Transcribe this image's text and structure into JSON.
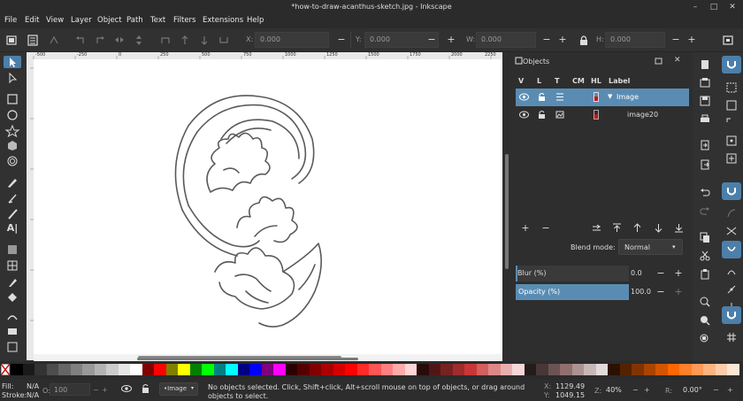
{
  "window": {
    "title": "*how-to-draw-acanthus-sketch.jpg - Inkscape",
    "controls": [
      "–",
      "□",
      "✕"
    ]
  },
  "menu": [
    "File",
    "Edit",
    "View",
    "Layer",
    "Object",
    "Path",
    "Text",
    "Filters",
    "Extensions",
    "Help"
  ],
  "toolbar": {
    "x_label": "X:",
    "x_value": "0.000",
    "y_label": "Y:",
    "y_value": "0.000",
    "w_label": "W:",
    "w_value": "0.000",
    "h_label": "H:",
    "h_value": "0.000",
    "minus": "−",
    "plus": "+"
  },
  "ruler": {
    "top_ticks": [
      "-500",
      "-250",
      "0",
      "250",
      "500",
      "750",
      "1000",
      "1250",
      "1500",
      "1750",
      "2000",
      "2250"
    ],
    "left_ticks": [
      "0",
      "250",
      "500",
      "750",
      "1000",
      "1250"
    ]
  },
  "objects_panel": {
    "title": "Objects",
    "columns": [
      "V",
      "L",
      "T",
      "CM",
      "HL",
      "Label"
    ],
    "rows": [
      {
        "label": "Image",
        "selected": true,
        "expanded": true,
        "hl_color": "#cc1111"
      },
      {
        "label": "image20",
        "selected": false,
        "expanded": false,
        "hl_color": "#cc1111"
      }
    ],
    "blend_label": "Blend mode:",
    "blend_value": "Normal",
    "blur_label": "Blur (%)",
    "blur_value": "0.0",
    "opacity_label": "Opacity (%)",
    "opacity_value": "100.0",
    "opacity_fraction": 1.0,
    "blur_fraction": 0.0,
    "add_icon": "+",
    "remove_icon": "−"
  },
  "status": {
    "fill_label": "Fill:",
    "fill_value": "N/A",
    "stroke_label": "Stroke:",
    "stroke_value": "N/A",
    "o_label": "O:",
    "o_value": "100",
    "layer_name": "•Image",
    "message": "No objects selected. Click, Shift+click, Alt+scroll mouse on top of objects, or drag around objects to select.",
    "x_label": "X:",
    "x_value": "1129.49",
    "y_label": "Y:",
    "y_value": "1049.15",
    "z_label": "Z:",
    "zoom": "40%",
    "r_label": "R:",
    "rotation": "0.00°"
  },
  "palette": [
    "#000000",
    "#1a1a1a",
    "#333333",
    "#4d4d4d",
    "#666666",
    "#808080",
    "#999999",
    "#b3b3b3",
    "#cccccc",
    "#e6e6e6",
    "#ffffff",
    "#800000",
    "#ff0000",
    "#808000",
    "#ffff00",
    "#008000",
    "#00ff00",
    "#008080",
    "#00ffff",
    "#000080",
    "#0000ff",
    "#800080",
    "#ff00ff",
    "#2b0000",
    "#550000",
    "#800000",
    "#aa0000",
    "#d40000",
    "#ff0000",
    "#ff2a2a",
    "#ff5555",
    "#ff8080",
    "#ffaaaa",
    "#ffd5d5",
    "#280b0b",
    "#501616",
    "#782121",
    "#a02c2c",
    "#c83737",
    "#d35f5f",
    "#de8787",
    "#e9afaf",
    "#f4d7d7",
    "#241c1c",
    "#483737",
    "#6c5353",
    "#916f6f",
    "#ac9393",
    "#c8b7b7",
    "#e3dbdb",
    "#2b1100",
    "#552200",
    "#803300",
    "#aa4400",
    "#d45500",
    "#ff6600",
    "#ff7f2a",
    "#ff9955",
    "#ffb380",
    "#ffccaa",
    "#ffe6d5"
  ]
}
